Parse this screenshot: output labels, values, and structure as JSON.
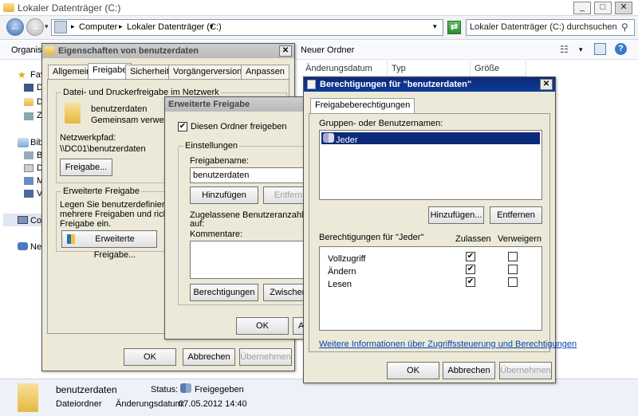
{
  "explorer": {
    "title": "Lokaler Datenträger (C:)",
    "breadcrumb": [
      "Computer",
      "Lokaler Datenträger (C:)"
    ],
    "search_placeholder": "Lokaler Datenträger (C:) durchsuchen",
    "toolbar_organize": "Organisie",
    "toolbar_new_folder": "Neuer Ordner",
    "columns": [
      "Änderungsdatum",
      "Typ",
      "Größe"
    ],
    "sidebar": [
      {
        "label": "Fav"
      },
      {
        "label": "D"
      },
      {
        "label": "D"
      },
      {
        "label": "Z"
      },
      {
        "label": "Bib"
      },
      {
        "label": "B"
      },
      {
        "label": "D"
      },
      {
        "label": "M"
      },
      {
        "label": "V"
      },
      {
        "label": "Co"
      },
      {
        "label": "Ne"
      }
    ],
    "status": {
      "name": "benutzerdaten",
      "type": "Dateiordner",
      "status_label": "Status:",
      "status_value": "Freigegeben",
      "modified_label": "Änderungsdatum:",
      "modified_value": "07.05.2012 14:40"
    }
  },
  "properties_dialog": {
    "title": "Eigenschaften von benutzerdaten",
    "tabs": [
      "Allgemein",
      "Freigabe",
      "Sicherheit",
      "Vorgängerversionen",
      "Anpassen"
    ],
    "net_group": "Datei- und Druckerfreigabe im Netzwerk",
    "folder_name": "benutzerdaten",
    "folder_state": "Gemeinsam verwend",
    "net_path_label": "Netzwerkpfad:",
    "net_path": "\\\\DC01\\benutzerdaten",
    "share_button": "Freigabe...",
    "adv_group": "Erweiterte Freigabe",
    "adv_text_1": "Legen Sie benutzerdefinierte B",
    "adv_text_2": "mehrere Freigaben und richten",
    "adv_text_3": "Freigabe ein.",
    "adv_button": "Erweiterte Freigabe...",
    "ok": "OK",
    "cancel": "Abbrechen",
    "apply": "Übernehmen"
  },
  "advanced_dialog": {
    "title": "Erweiterte Freigabe",
    "share_checkbox": "Diesen Ordner freigeben",
    "settings_group": "Einstellungen",
    "share_name_label": "Freigabename:",
    "share_name_value": "benutzerdaten",
    "add_button": "Hinzufügen",
    "remove_button": "Entfern",
    "limit_text_1": "Zugelassene Benutzeranzahl einsc",
    "limit_text_2": "auf:",
    "comments_label": "Kommentare:",
    "permissions_button": "Berechtigungen",
    "cache_button": "Zwischen",
    "ok": "OK",
    "cancel": "A"
  },
  "permissions_dialog": {
    "title": "Berechtigungen für \"benutzerdaten\"",
    "tab": "Freigabeberechtigungen",
    "groups_label": "Gruppen- oder Benutzernamen:",
    "groups": [
      "Jeder"
    ],
    "add_button": "Hinzufügen...",
    "remove_button": "Entfernen",
    "perm_label": "Berechtigungen für \"Jeder\"",
    "allow_col": "Zulassen",
    "deny_col": "Verweigern",
    "permissions": [
      {
        "name": "Vollzugriff",
        "allow": true,
        "deny": false
      },
      {
        "name": "Ändern",
        "allow": true,
        "deny": false
      },
      {
        "name": "Lesen",
        "allow": true,
        "deny": false
      }
    ],
    "info_link": "Weitere Informationen über Zugriffssteuerung und Berechtigungen",
    "ok": "OK",
    "cancel": "Abbrechen",
    "apply": "Übernehmen"
  }
}
